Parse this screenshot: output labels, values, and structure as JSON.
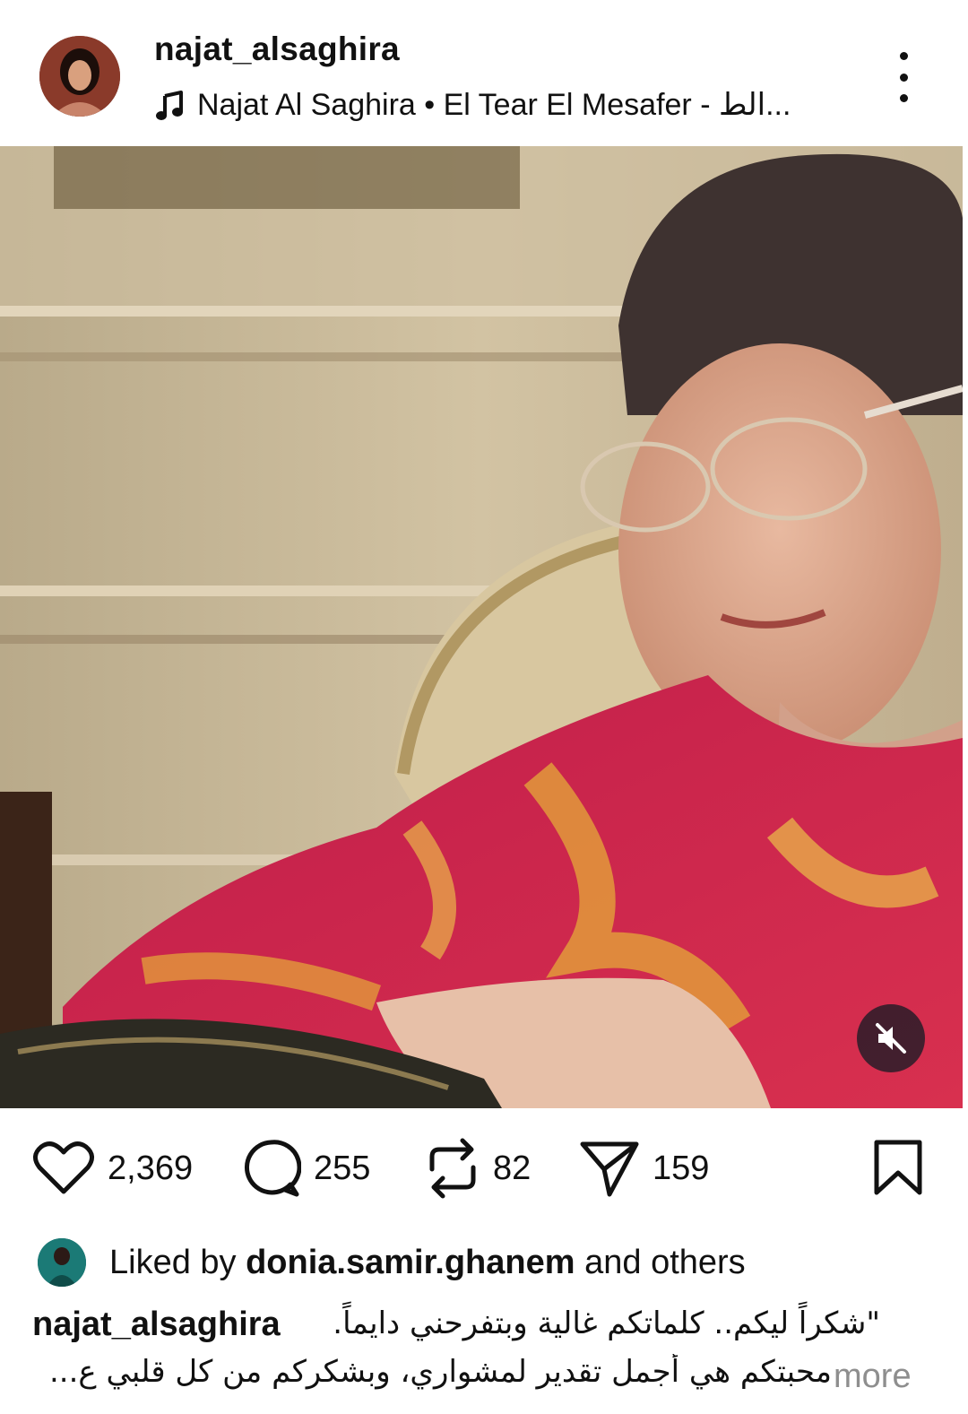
{
  "post": {
    "username": "najat_alsaghira",
    "music": "Najat Al Saghira • El Tear El Mesafer - الط...",
    "likes": "2,369",
    "comments": "255",
    "reposts": "82",
    "shares": "159",
    "liked_by_prefix": "Liked by ",
    "liked_by_user": "donia.samir.ghanem",
    "liked_by_suffix": " and others",
    "caption_user": "najat_alsaghira",
    "caption_line1": "\"شكراً ليكم.. كلماتكم غالية وبتفرحني دايماً.",
    "caption_line2": "محبتكم هي أجمل تقدير لمشواري، وبشكركم من كل قلبي ع...",
    "more_label": "more"
  },
  "icons": {
    "music": "music-note-icon",
    "more": "more-vertical-icon",
    "mute": "muted-speaker-icon",
    "like": "heart-icon",
    "comment": "comment-icon",
    "repost": "repost-icon",
    "share": "send-icon",
    "save": "bookmark-icon"
  },
  "colors": {
    "text": "#111111",
    "muted": "#8e8e8e",
    "background": "#ffffff"
  }
}
